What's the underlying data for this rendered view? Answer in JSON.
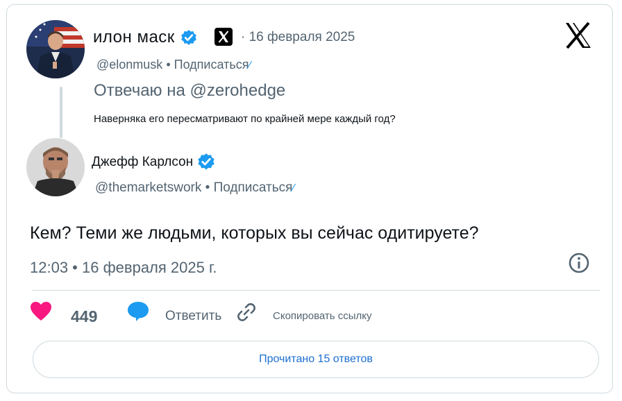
{
  "colors": {
    "accent": "#1d9bf0",
    "text_primary": "#0f1419",
    "text_secondary": "#536471",
    "like": "#f91880",
    "border": "#cfd9de"
  },
  "parent_tweet": {
    "author_name": "илон маск",
    "date": "· 16 февраля 2025",
    "handle": "@elonmusk",
    "separator": " • ",
    "follow_label": "Подписаться",
    "replying_to": "Отвечаю на @zerohedge",
    "text": "Наверняка его пересматривают по крайней мере каждый год?"
  },
  "reply_tweet": {
    "author_name": "Джефф Карлсон",
    "handle": "@themarketswork",
    "separator": " • ",
    "follow_label": "Подписаться",
    "text": "Кем? Теми же людьми, которых вы сейчас одитируете?",
    "timestamp": "12:03 • 16 февраля 2025 г."
  },
  "actions": {
    "like_count": "449",
    "reply_label": "Ответить",
    "copy_link_label": "Скопировать ссылку"
  },
  "read_replies_label": "Прочитано 15 ответов",
  "icons": {
    "verified": "verified-badge-icon",
    "x_logo": "x-logo-icon",
    "info": "info-icon",
    "heart": "heart-icon",
    "reply": "speech-bubble-icon",
    "link": "link-icon"
  }
}
